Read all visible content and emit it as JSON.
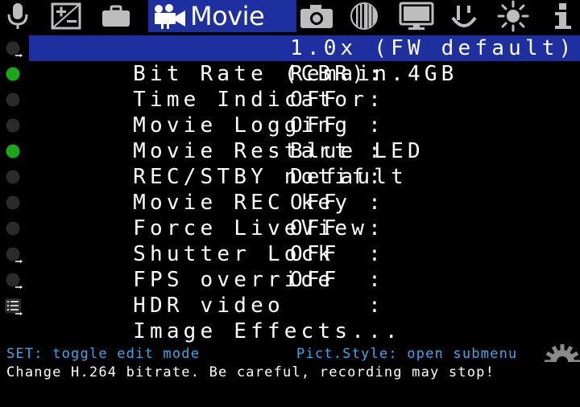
{
  "tabs": [
    {
      "id": "audio",
      "icon": "microphone-icon"
    },
    {
      "id": "expo",
      "icon": "exposure-icon"
    },
    {
      "id": "overlay",
      "icon": "briefcase-icon"
    },
    {
      "id": "movie",
      "icon": "movie-camera-icon",
      "label": "Movie",
      "active": true
    },
    {
      "id": "shoot",
      "icon": "camera-icon"
    },
    {
      "id": "focus",
      "icon": "focus-icon"
    },
    {
      "id": "display",
      "icon": "monitor-icon"
    },
    {
      "id": "prefs",
      "icon": "smile-icon"
    },
    {
      "id": "debug",
      "icon": "sun-icon"
    },
    {
      "id": "info",
      "icon": "info-icon"
    }
  ],
  "menu": {
    "items": [
      {
        "label": "Bit Rate (CBR):",
        "value": "1.0x (FW default)",
        "status": "submenu-off",
        "selected": true
      },
      {
        "label": "Time Indicator:",
        "value": "Remain.4GB",
        "status": "on"
      },
      {
        "label": "Movie Logging :",
        "value": "OFF",
        "status": "off"
      },
      {
        "label": "Movie Restart :",
        "value": "OFF",
        "status": "off"
      },
      {
        "label": "REC/STBY notif:",
        "value": "Blue LED",
        "status": "on"
      },
      {
        "label": "Movie REC key :",
        "value": "Default",
        "status": "off"
      },
      {
        "label": "Force LiveView:",
        "value": "OFF",
        "status": "off"
      },
      {
        "label": "Shutter Lock  :",
        "value": "OFF",
        "status": "off"
      },
      {
        "label": "FPS override  :",
        "value": "OFF",
        "status": "submenu-off"
      },
      {
        "label": "HDR video     :",
        "value": "OFF",
        "status": "submenu-off"
      },
      {
        "label": "Image Effects...",
        "value": "",
        "status": "list"
      }
    ]
  },
  "help": {
    "left": "SET: toggle edit mode",
    "right": "Pict.Style: open submenu",
    "description": "Change H.264 bitrate. Be careful, recording may stop!"
  },
  "colors": {
    "accent": "#1e2fa0",
    "on": "#1aa81a",
    "off": "#2a2a2a",
    "help": "#3fa6e8"
  }
}
